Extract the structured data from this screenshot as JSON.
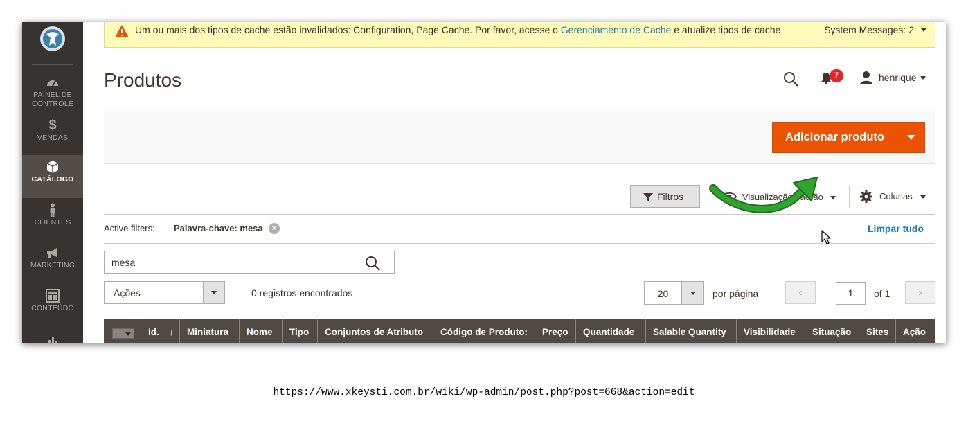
{
  "sidebar": {
    "logo_icon": "magento-logo-icon",
    "items": [
      {
        "label": "PAINEL DE CONTROLE",
        "icon": "dashboard-icon"
      },
      {
        "label": "VENDAS",
        "icon": "dollar-icon"
      },
      {
        "label": "CATÁLOGO",
        "icon": "box-icon",
        "active": true
      },
      {
        "label": "CLIENTES",
        "icon": "person-icon"
      },
      {
        "label": "MARKETING",
        "icon": "megaphone-icon"
      },
      {
        "label": "CONTEÚDO",
        "icon": "layout-icon"
      }
    ]
  },
  "system_message": {
    "text_before": "Um ou mais dos tipos de cache estão invalidados: Configuration, Page Cache. Por favor, acesse o",
    "link": "Gerenciamento de Cache",
    "text_after": "e atualize tipos de cache.",
    "counter": "System Messages: 2"
  },
  "header": {
    "title": "Produtos",
    "notifications_count": "7",
    "user_name": "henrique"
  },
  "page_actions": {
    "add_product": "Adicionar produto"
  },
  "grid_controls": {
    "filters": "Filtros",
    "view": "Visualização padrão",
    "columns": "Colunas"
  },
  "active_filters": {
    "label": "Active filters:",
    "chip": "Palavra-chave: mesa",
    "remove": "×",
    "clear_all": "Limpar tudo"
  },
  "search": {
    "value": "mesa"
  },
  "toolbar": {
    "actions": "Ações",
    "records": "0 registros encontrados",
    "per_page_value": "20",
    "per_page_label": "por página",
    "prev": "‹",
    "page": "1",
    "of": "of 1",
    "next": "›"
  },
  "table": {
    "columns": [
      "Id.",
      "Miniatura",
      "Nome",
      "Tipo",
      "Conjuntos de Atributo",
      "Código de Produto:",
      "Preço",
      "Quantidade",
      "Salable Quantity",
      "Visibilidade",
      "Situação",
      "Sites",
      "Ação"
    ],
    "sort_indicator": "↓"
  },
  "annotation": {
    "arrow_color": "#2a8f2a"
  },
  "caption": {
    "url": "https://www.xkeysti.com.br/wiki/wp-admin/post.php?post=668&action=edit"
  },
  "colors": {
    "sidebar": "#373330",
    "primary_button": "#eb5202",
    "banner": "#fffbbb",
    "link": "#1979c3",
    "table_header": "#514943"
  }
}
